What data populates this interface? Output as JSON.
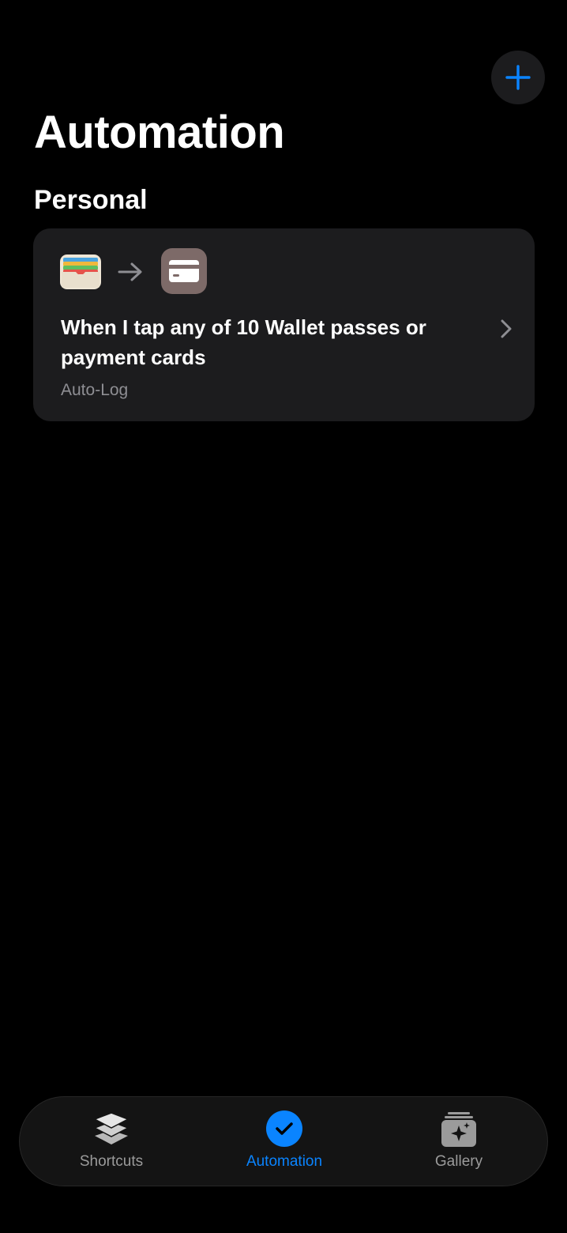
{
  "header": {
    "title": "Automation",
    "add_button_icon": "plus-icon"
  },
  "sections": [
    {
      "title": "Personal",
      "items": [
        {
          "trigger_icon": "wallet-icon",
          "action_icon": "card-icon",
          "title": "When I tap any of 10 Wallet passes or payment cards",
          "subtitle": "Auto-Log"
        }
      ]
    }
  ],
  "tab_bar": {
    "tabs": [
      {
        "label": "Shortcuts",
        "icon": "stack-icon",
        "active": false
      },
      {
        "label": "Automation",
        "icon": "checkmark-circle-icon",
        "active": true
      },
      {
        "label": "Gallery",
        "icon": "sparkle-gallery-icon",
        "active": false
      }
    ]
  },
  "colors": {
    "accent": "#0a84ff",
    "background": "#000000",
    "card": "#1c1c1e",
    "secondary_text": "#8e8e93"
  }
}
